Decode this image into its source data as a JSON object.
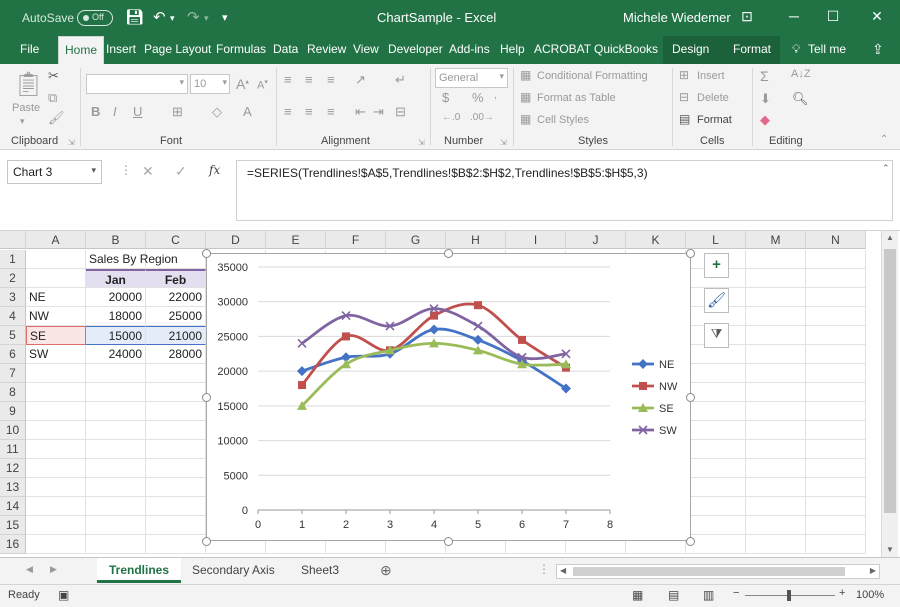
{
  "titlebar": {
    "autosave_label": "AutoSave",
    "autosave_state": "Off",
    "doc_title": "ChartSample  -  Excel",
    "user": "Michele Wiedemer"
  },
  "tabs": [
    "File",
    "Home",
    "Insert",
    "Page Layout",
    "Formulas",
    "Data",
    "Review",
    "View",
    "Developer",
    "Add-ins",
    "Help",
    "ACROBAT",
    "QuickBooks",
    "Design",
    "Format"
  ],
  "tell_me": "Tell me",
  "ribbon": {
    "groups": {
      "clipboard": "Clipboard",
      "font": "Font",
      "alignment": "Alignment",
      "number": "Number",
      "styles": "Styles",
      "cells": "Cells",
      "editing": "Editing"
    },
    "paste": "Paste",
    "font_size": "10",
    "number_format": "General",
    "conditional_formatting": "Conditional Formatting",
    "format_as_table": "Format as Table",
    "cell_styles": "Cell Styles",
    "insert": "Insert",
    "delete": "Delete",
    "format": "Format"
  },
  "formula_bar": {
    "name_box": "Chart 3",
    "fx": "fx",
    "formula": "=SERIES(Trendlines!$A$5,Trendlines!$B$2:$H$2,Trendlines!$B$5:$H$5,3)"
  },
  "columns": [
    "A",
    "B",
    "C",
    "D",
    "E",
    "F",
    "G",
    "H",
    "I",
    "J",
    "K",
    "L",
    "M",
    "N"
  ],
  "rows": [
    "1",
    "2",
    "3",
    "4",
    "5",
    "6",
    "7",
    "8",
    "9",
    "10",
    "11",
    "12",
    "13",
    "14",
    "15",
    "16"
  ],
  "sheet": {
    "title": "Sales By Region",
    "headers": [
      "Jan",
      "Feb"
    ],
    "regions": [
      "NE",
      "NW",
      "SE",
      "SW"
    ],
    "jan": [
      "20000",
      "18000",
      "15000",
      "24000"
    ],
    "feb": [
      "22000",
      "25000",
      "21000",
      "28000"
    ]
  },
  "chart_data": {
    "type": "line",
    "x": [
      1,
      2,
      3,
      4,
      5,
      6,
      7
    ],
    "xlim": [
      0,
      8
    ],
    "ylim": [
      0,
      35000
    ],
    "xticks": [
      "0",
      "1",
      "2",
      "3",
      "4",
      "5",
      "6",
      "7",
      "8"
    ],
    "yticks": [
      "0",
      "5000",
      "10000",
      "15000",
      "20000",
      "25000",
      "30000",
      "35000"
    ],
    "grid": "horizontal",
    "legend": "right",
    "series": [
      {
        "name": "NE",
        "color": "#4472c4",
        "marker": "diamond",
        "values": [
          20000,
          22000,
          22500,
          26000,
          24500,
          21500,
          17500
        ]
      },
      {
        "name": "NW",
        "color": "#c0504d",
        "marker": "square",
        "values": [
          18000,
          25000,
          23000,
          28000,
          29500,
          24500,
          20500
        ]
      },
      {
        "name": "SE",
        "color": "#9bbb59",
        "marker": "triangle",
        "values": [
          15000,
          21000,
          23000,
          24000,
          23000,
          21000,
          21000
        ]
      },
      {
        "name": "SW",
        "color": "#8064a2",
        "marker": "x",
        "values": [
          24000,
          28000,
          26500,
          29000,
          26500,
          22000,
          22500
        ]
      }
    ]
  },
  "sheet_tabs": [
    "Trendlines",
    "Secondary Axis",
    "Sheet3"
  ],
  "status": {
    "ready": "Ready",
    "zoom": "100%"
  },
  "colors": {
    "accent": "#217346"
  }
}
